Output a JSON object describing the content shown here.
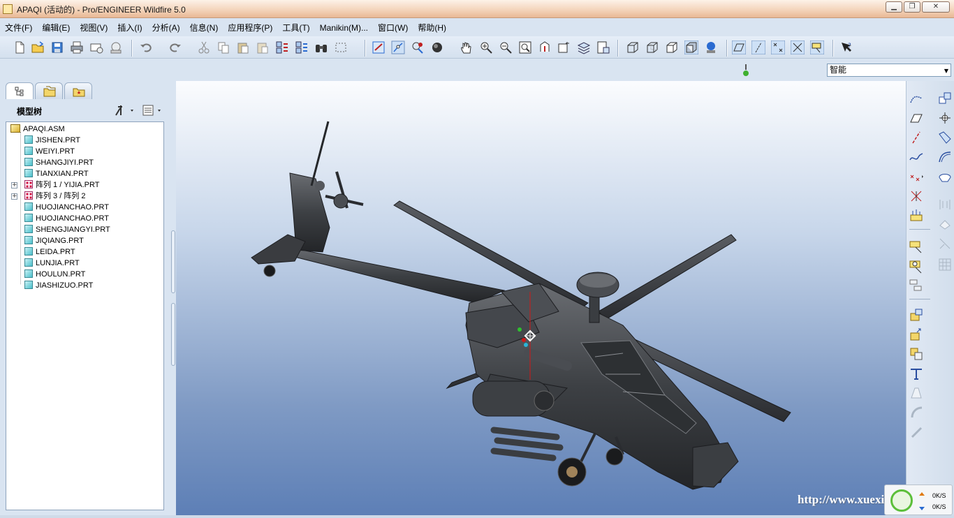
{
  "window": {
    "title": "APAQI (活动的) - Pro/ENGINEER Wildfire 5.0",
    "buttons": [
      "▁",
      "❐",
      "✕"
    ]
  },
  "menu": [
    "文件(F)",
    "编辑(E)",
    "视图(V)",
    "插入(I)",
    "分析(A)",
    "信息(N)",
    "应用程序(P)",
    "工具(T)",
    "Manikin(M)...",
    "窗口(W)",
    "帮助(H)"
  ],
  "filter": {
    "value": "智能"
  },
  "model_tree": {
    "header": "模型树",
    "items": [
      {
        "label": "APAQI.ASM",
        "kind": "asm"
      },
      {
        "label": "JISHEN.PRT",
        "kind": "part"
      },
      {
        "label": "WEIYI.PRT",
        "kind": "part"
      },
      {
        "label": "SHANGJIYI.PRT",
        "kind": "part"
      },
      {
        "label": "TIANXIAN.PRT",
        "kind": "part"
      },
      {
        "label": "阵列 1 / YIJIA.PRT",
        "kind": "pattern"
      },
      {
        "label": "阵列 3 / 阵列 2",
        "kind": "pattern"
      },
      {
        "label": "HUOJIANCHAO.PRT",
        "kind": "part"
      },
      {
        "label": "HUOJIANCHAO.PRT",
        "kind": "part"
      },
      {
        "label": "SHENGJIANGYI.PRT",
        "kind": "part"
      },
      {
        "label": "JIQIANG.PRT",
        "kind": "part"
      },
      {
        "label": "LEIDA.PRT",
        "kind": "part"
      },
      {
        "label": "LUNJIA.PRT",
        "kind": "part"
      },
      {
        "label": "HOULUN.PRT",
        "kind": "part"
      },
      {
        "label": "JIASHIZUO.PRT",
        "kind": "part"
      }
    ]
  },
  "watermark": "http://www.xuexiao.com",
  "net_meter": {
    "up": "0K/S",
    "down": "0K/S"
  },
  "colors": {
    "accent": "#d9e4f1",
    "viewport_bottom": "#5d7fb6",
    "model": "#3c3e42"
  }
}
